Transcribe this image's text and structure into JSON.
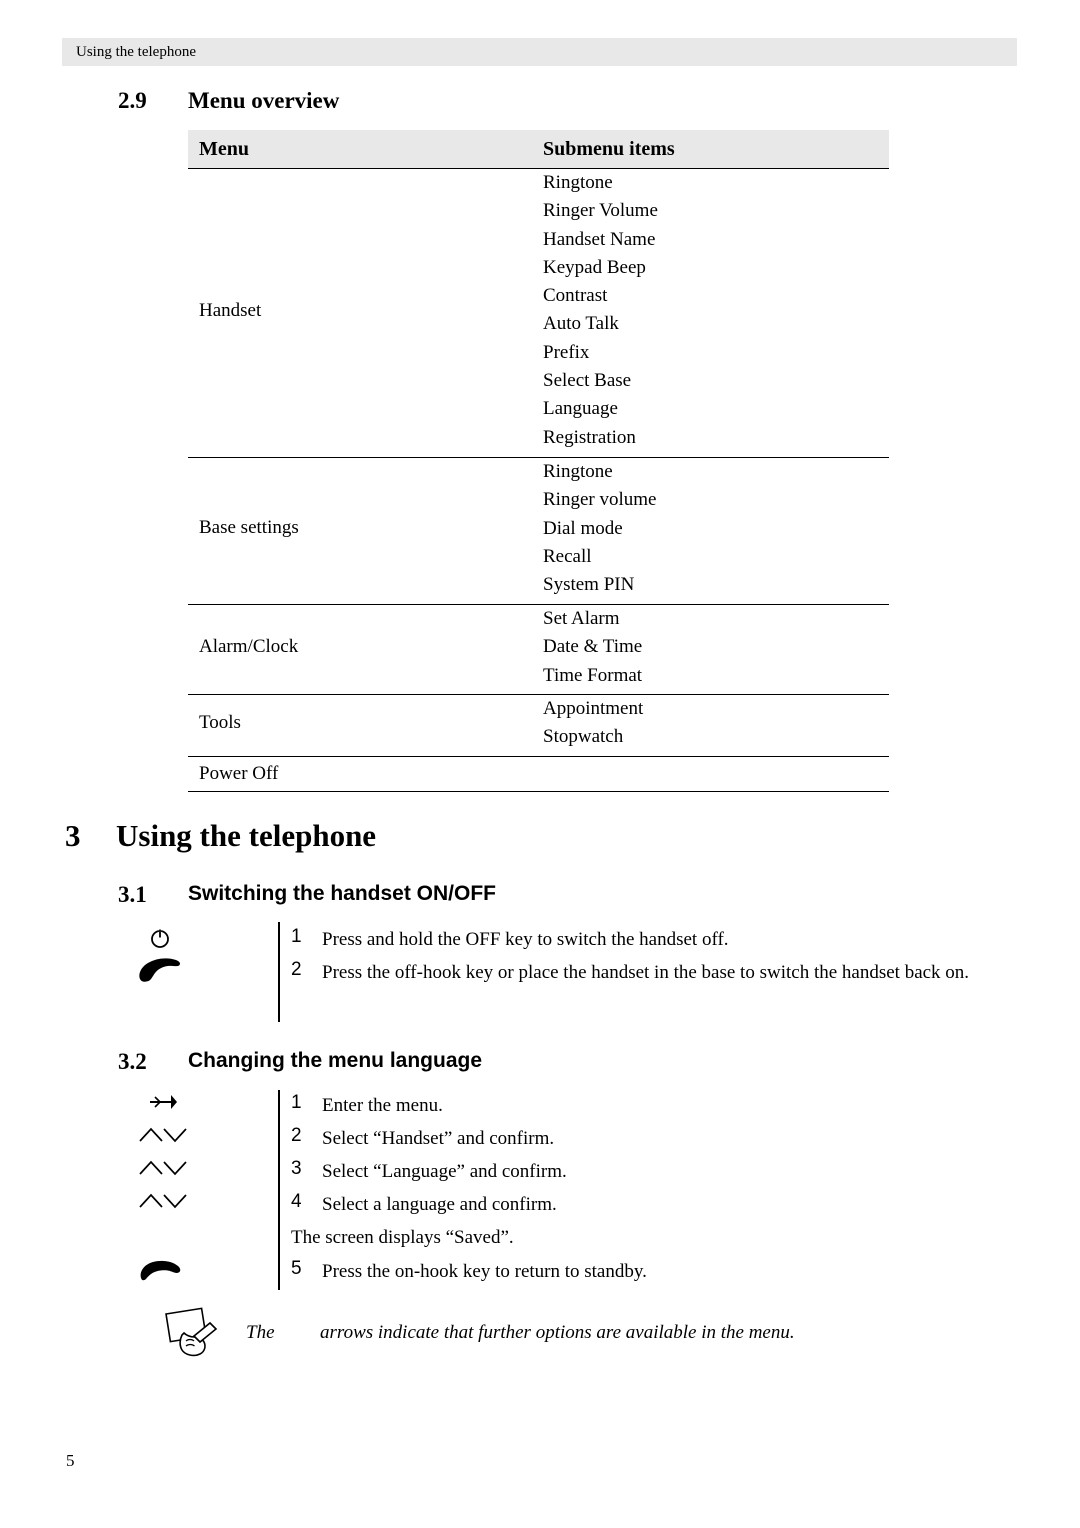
{
  "header": {
    "running_head": "Using the telephone"
  },
  "section_29": {
    "number": "2.9",
    "title": "Menu overview"
  },
  "table": {
    "columns": [
      "Menu",
      "Submenu items"
    ],
    "rows": [
      {
        "menu": "Handset",
        "submenu": [
          "Ringtone",
          "Ringer Volume",
          "Handset Name",
          "Keypad Beep",
          "Contrast",
          "Auto Talk",
          "Prefix",
          "Select Base",
          "Language",
          "Registration"
        ]
      },
      {
        "menu": "Base settings",
        "submenu": [
          "Ringtone",
          "Ringer volume",
          "Dial mode",
          "Recall",
          "System PIN"
        ]
      },
      {
        "menu": "Alarm/Clock",
        "submenu": [
          "Set Alarm",
          "Date & Time",
          "Time Format"
        ]
      },
      {
        "menu": "Tools",
        "submenu": [
          "Appointment",
          "Stopwatch"
        ]
      },
      {
        "menu": "Power Off",
        "submenu": []
      }
    ]
  },
  "chapter_3": {
    "number": "3",
    "title": "Using the telephone"
  },
  "section_31": {
    "number": "3.1",
    "title": "Switching the handset ON/OFF",
    "steps": [
      {
        "num": "1",
        "icon": "power-icon",
        "text": "Press and hold the OFF key to switch the handset off."
      },
      {
        "num": "2",
        "icon": "off-hook-handset-icon",
        "text": "Press the off-hook key or place the handset in the base to switch the handset back on."
      }
    ]
  },
  "section_32": {
    "number": "3.2",
    "title": "Changing the menu language",
    "steps": [
      {
        "num": "1",
        "icon": "menu-enter-arrow-icon",
        "text": "Enter the menu."
      },
      {
        "num": "2",
        "icon": "up-down-arrows-icon",
        "text": "Select “Handset” and confirm."
      },
      {
        "num": "3",
        "icon": "up-down-arrows-icon",
        "text": "Select “Language” and confirm."
      },
      {
        "num": "4",
        "icon": "up-down-arrows-icon",
        "text": "Select a language and confirm."
      },
      {
        "num": "",
        "icon": "",
        "text": "The screen displays “Saved”."
      },
      {
        "num": "5",
        "icon": "on-hook-handset-icon",
        "text": "Press the on-hook key to return to standby."
      }
    ]
  },
  "note": {
    "icon": "note-hand-icon",
    "lead": "The",
    "text": "arrows indicate that further options are available in the menu."
  },
  "footer": {
    "page_number": "5"
  }
}
